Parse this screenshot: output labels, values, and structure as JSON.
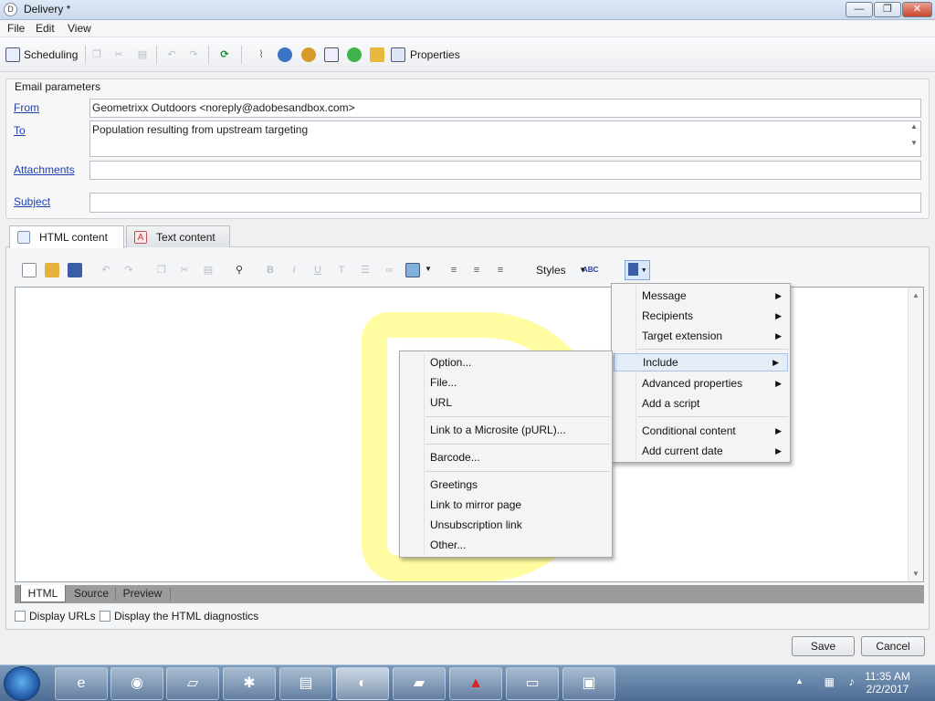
{
  "window": {
    "title": "Delivery *"
  },
  "menubar": [
    "File",
    "Edit",
    "View"
  ],
  "toolbar": {
    "scheduling_label": "Scheduling",
    "properties_label": "Properties"
  },
  "email_params": {
    "legend": "Email parameters",
    "from_label": "From",
    "from_value": "Geometrixx Outdoors <noreply@adobesandbox.com>",
    "to_label": "To",
    "to_value": "Population resulting from upstream targeting",
    "attachments_label": "Attachments",
    "attachments_value": "",
    "subject_label": "Subject",
    "subject_value": ""
  },
  "content_tabs": [
    "HTML content",
    "Text content"
  ],
  "editor_toolbar": {
    "styles_label": "Styles"
  },
  "editor_tabs": [
    "HTML",
    "Source",
    "Preview"
  ],
  "checkboxes": [
    "Display URLs",
    "Display the HTML diagnostics"
  ],
  "buttons": {
    "save": "Save",
    "cancel": "Cancel"
  },
  "personalization_menu": [
    {
      "label": "Message",
      "submenu": true
    },
    {
      "label": "Recipients",
      "submenu": true
    },
    {
      "label": "Target extension",
      "submenu": true
    },
    {
      "label": "Include",
      "submenu": true,
      "highlighted": true
    },
    {
      "label": "Advanced properties",
      "submenu": true
    },
    {
      "label": "Add a script",
      "submenu": false
    },
    {
      "label": "Conditional content",
      "submenu": true
    },
    {
      "label": "Add current date",
      "submenu": true
    }
  ],
  "include_submenu": [
    "Option...",
    "File...",
    "URL",
    "Link to a Microsite (pURL)...",
    "Barcode...",
    "Greetings",
    "Link to mirror page",
    "Unsubscription link",
    "Other..."
  ],
  "tray": {
    "time": "11:35 AM",
    "date": "2/2/2017"
  },
  "colors": {
    "link": "#1f3fae",
    "watermark": "#fffc91",
    "titlebar": "#c9d9ec"
  }
}
